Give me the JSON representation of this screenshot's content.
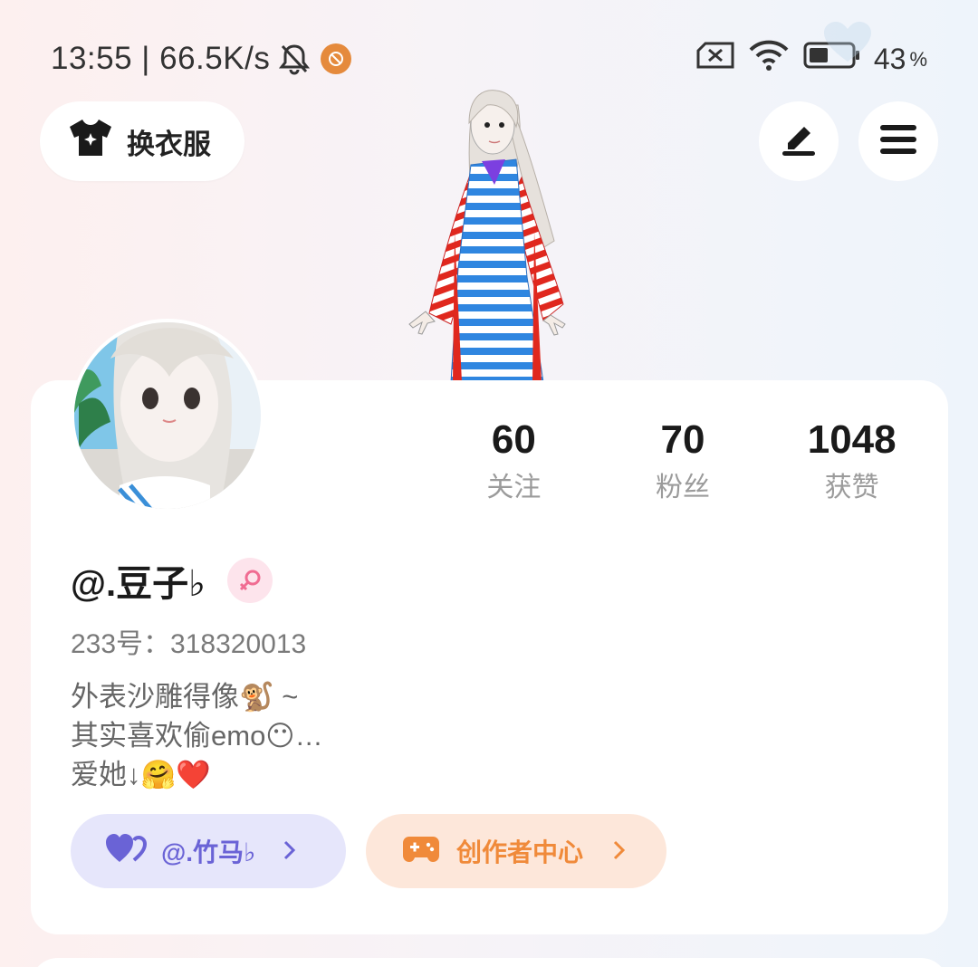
{
  "status_bar": {
    "time_speed": "13:55 | 66.5K/s",
    "battery": "43",
    "battery_unit": "%",
    "icons": [
      "bell-muted-icon",
      "app-badge-icon",
      "sim-off-icon",
      "wifi-icon",
      "battery-icon"
    ]
  },
  "header": {
    "outfit_label": "换衣服",
    "icons": [
      "shirt-icon",
      "edit-icon",
      "menu-icon"
    ]
  },
  "profile": {
    "stats": [
      {
        "value": "60",
        "label": "关注"
      },
      {
        "value": "70",
        "label": "粉丝"
      },
      {
        "value": "1048",
        "label": "获赞"
      }
    ],
    "username": "@.豆子♭",
    "uid": "233号：318320013",
    "bio": [
      "外表沙雕得像🐒 ~",
      "其实喜欢偷emo😶…",
      "爱她↓🤗❤️"
    ],
    "partner_chip": "@.竹马♭",
    "creator_chip": "创作者中心"
  },
  "colors": {
    "partner_bg": "#e6e6fb",
    "partner_text": "#6a63d6",
    "creator_bg": "#fde7da",
    "creator_text": "#f08a3a",
    "gender_badge": "#fde4ec"
  }
}
